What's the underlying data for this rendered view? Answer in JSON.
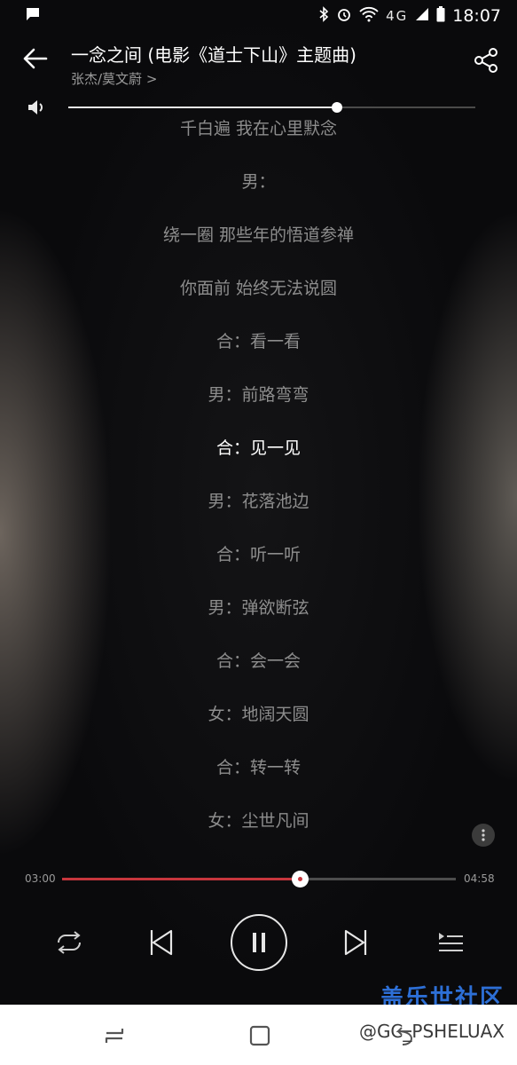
{
  "status_bar": {
    "time": "18:07",
    "icons": [
      "chat-bubble-icon",
      "bluetooth-icon",
      "alarm-icon",
      "wifi-icon",
      "signal-icon",
      "battery-icon"
    ],
    "network": "4G"
  },
  "header": {
    "title": "一念之间 (电影《道士下山》主题曲)",
    "artist": "张杰/莫文蔚 >"
  },
  "volume": {
    "level": 0.66
  },
  "lyrics": [
    "千白遍 我在心里默念",
    "男：",
    "绕一圈 那些年的悟道参禅",
    "你面前 始终无法说圆",
    "合：看一看",
    "男：前路弯弯",
    "合：见一见",
    "男：花落池边",
    "合：听一听",
    "男：弹欲断弦",
    "合：会一会",
    "女：地阔天圆",
    "合：转一转",
    "女：尘世凡间"
  ],
  "active_lyric_index": 6,
  "playback": {
    "elapsed": "03:00",
    "total": "04:58",
    "progress": 0.604
  },
  "colors": {
    "accent": "#c7363d",
    "lyric_inactive": "#8d8d8d",
    "lyric_active": "#ffffff",
    "watermark": "#2d6fd6"
  },
  "watermark": {
    "logo": "盖乐世社区",
    "handle": "@GC_PSHELUAX"
  }
}
